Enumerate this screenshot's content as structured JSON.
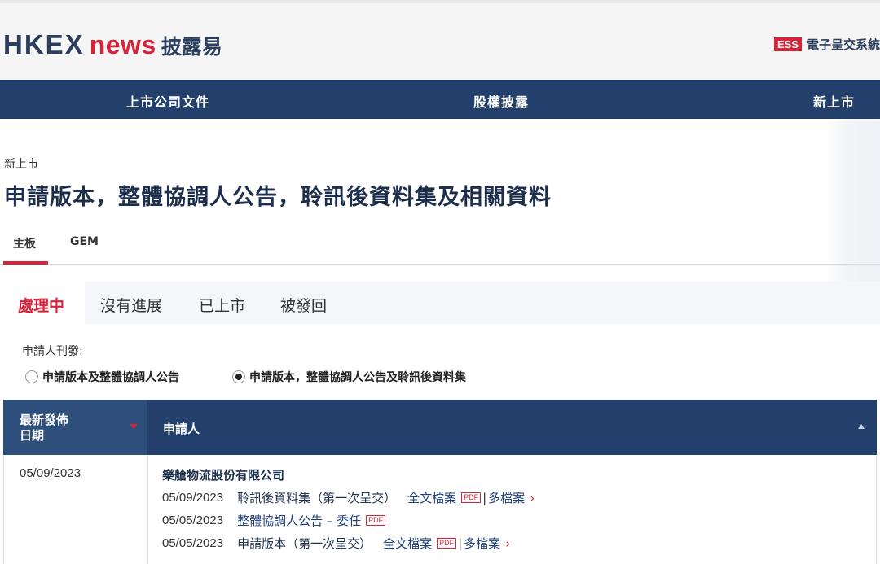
{
  "header": {
    "logo": {
      "hkex": "HKE",
      "x": "X",
      "news": "news",
      "cn": "披露易"
    },
    "ess_badge": "ESS",
    "ess_label": "電子呈交系統"
  },
  "nav": {
    "items": [
      "上市公司文件",
      "股權披露",
      "新上市"
    ]
  },
  "breadcrumb": "新上市",
  "page_title": "申請版本，整體協調人公告，聆訊後資料集及相關資料",
  "board_tabs": [
    "主板",
    "GEM"
  ],
  "status_tabs": [
    "處理中",
    "沒有進展",
    "已上市",
    "被發回"
  ],
  "publisher": {
    "label": "申請人刊發:",
    "options": [
      "申請版本及整體協調人公告",
      "申請版本，整體協調人公告及聆訊後資料集"
    ],
    "selected": 1
  },
  "table": {
    "headers": {
      "date": "最新發佈\n日期",
      "applicant": "申請人"
    },
    "rows": [
      {
        "date": "05/09/2023",
        "company": "樂艙物流股份有限公司",
        "docs": [
          {
            "date": "05/09/2023",
            "title": "聆訊後資料集（第一次呈交）",
            "link": "全文檔案",
            "pdf": "PDF",
            "more": "多檔案"
          },
          {
            "date": "05/05/2023",
            "title": "整體協調人公告 – 委任",
            "pdf": "PDF"
          },
          {
            "date": "05/05/2023",
            "title": "申請版本（第一次呈交）",
            "link": "全文檔案",
            "pdf": "PDF",
            "more": "多檔案"
          }
        ]
      }
    ]
  },
  "colors": {
    "brand_navy": "#22406b",
    "brand_red": "#d5243a"
  }
}
